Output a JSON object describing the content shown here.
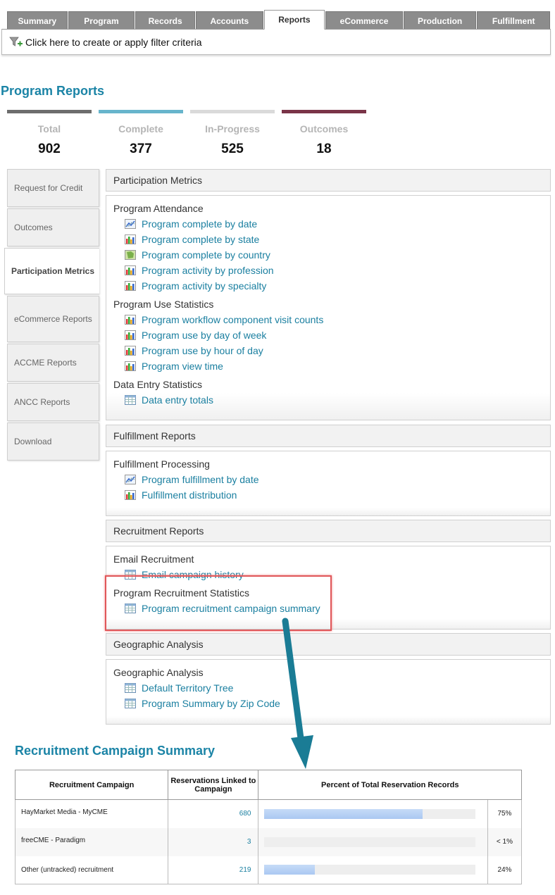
{
  "tabs": [
    "Summary",
    "Program",
    "Records",
    "Accounts",
    "Reports",
    "eCommerce",
    "Production",
    "Fulfillment"
  ],
  "active_tab": "Reports",
  "filter_text": "Click here to create or apply filter criteria",
  "page_title": "Program Reports",
  "stats": [
    {
      "label": "Total",
      "value": "902",
      "color": "#6d6d6d"
    },
    {
      "label": "Complete",
      "value": "377",
      "color": "#67b5cc"
    },
    {
      "label": "In-Progress",
      "value": "525",
      "color": "#dadada"
    },
    {
      "label": "Outcomes",
      "value": "18",
      "color": "#7a3448"
    }
  ],
  "side_nav": [
    {
      "label": "Request for Credit"
    },
    {
      "label": "Outcomes"
    },
    {
      "label": "Participation Metrics",
      "active": true
    },
    {
      "label": "eCommerce Reports"
    },
    {
      "label": "ACCME Reports"
    },
    {
      "label": "ANCC Reports"
    },
    {
      "label": "Download"
    }
  ],
  "panels": {
    "participation": {
      "title": "Participation Metrics",
      "groups": [
        {
          "name": "Program Attendance",
          "links": [
            {
              "text": "Program complete by date",
              "icon": "line-chart-icon"
            },
            {
              "text": "Program complete by state",
              "icon": "bar-chart-icon"
            },
            {
              "text": "Program complete by country",
              "icon": "map-chart-icon"
            },
            {
              "text": "Program activity by profession",
              "icon": "bar-chart-icon"
            },
            {
              "text": "Program activity by specialty",
              "icon": "bar-chart-icon"
            }
          ]
        },
        {
          "name": "Program Use Statistics",
          "links": [
            {
              "text": "Program workflow component visit counts",
              "icon": "bar-chart-icon"
            },
            {
              "text": "Program use by day of week",
              "icon": "bar-chart-icon"
            },
            {
              "text": "Program use by hour of day",
              "icon": "bar-chart-icon"
            },
            {
              "text": "Program view time",
              "icon": "bar-chart-icon"
            }
          ]
        },
        {
          "name": "Data Entry Statistics",
          "links": [
            {
              "text": "Data entry totals",
              "icon": "table-icon"
            }
          ]
        }
      ]
    },
    "fulfillment": {
      "title": "Fulfillment Reports",
      "group": "Fulfillment Processing",
      "links": [
        "Program fulfillment by date",
        "Fulfillment distribution"
      ]
    },
    "recruitment": {
      "title": "Recruitment Reports",
      "group1": "Email Recruitment",
      "link1": "Email campaign history",
      "group2": "Program Recruitment Statistics",
      "link2": "Program recruitment campaign summary"
    },
    "geographic": {
      "title": "Geographic Analysis",
      "group": "Geographic Analysis",
      "links": [
        "Default Territory Tree",
        "Program Summary by Zip Code"
      ]
    }
  },
  "campaign_summary": {
    "title": "Recruitment Campaign Summary",
    "headers": [
      "Recruitment Campaign",
      "Reservations Linked to Campaign",
      "Percent of Total Reservation Records"
    ],
    "rows": [
      {
        "campaign": "HayMarket Media - MyCME",
        "reservations": "680",
        "percent_label": "75%",
        "fraction": 0.75
      },
      {
        "campaign": "freeCME - Paradigm",
        "reservations": "3",
        "percent_label": "< 1%",
        "fraction": 0.0
      },
      {
        "campaign": "Other (untracked) recruitment",
        "reservations": "219",
        "percent_label": "24%",
        "fraction": 0.24
      }
    ]
  },
  "colors": {
    "accent": "#1b84a6",
    "highlight": "#e0575a",
    "arrow": "#1a7c95"
  }
}
